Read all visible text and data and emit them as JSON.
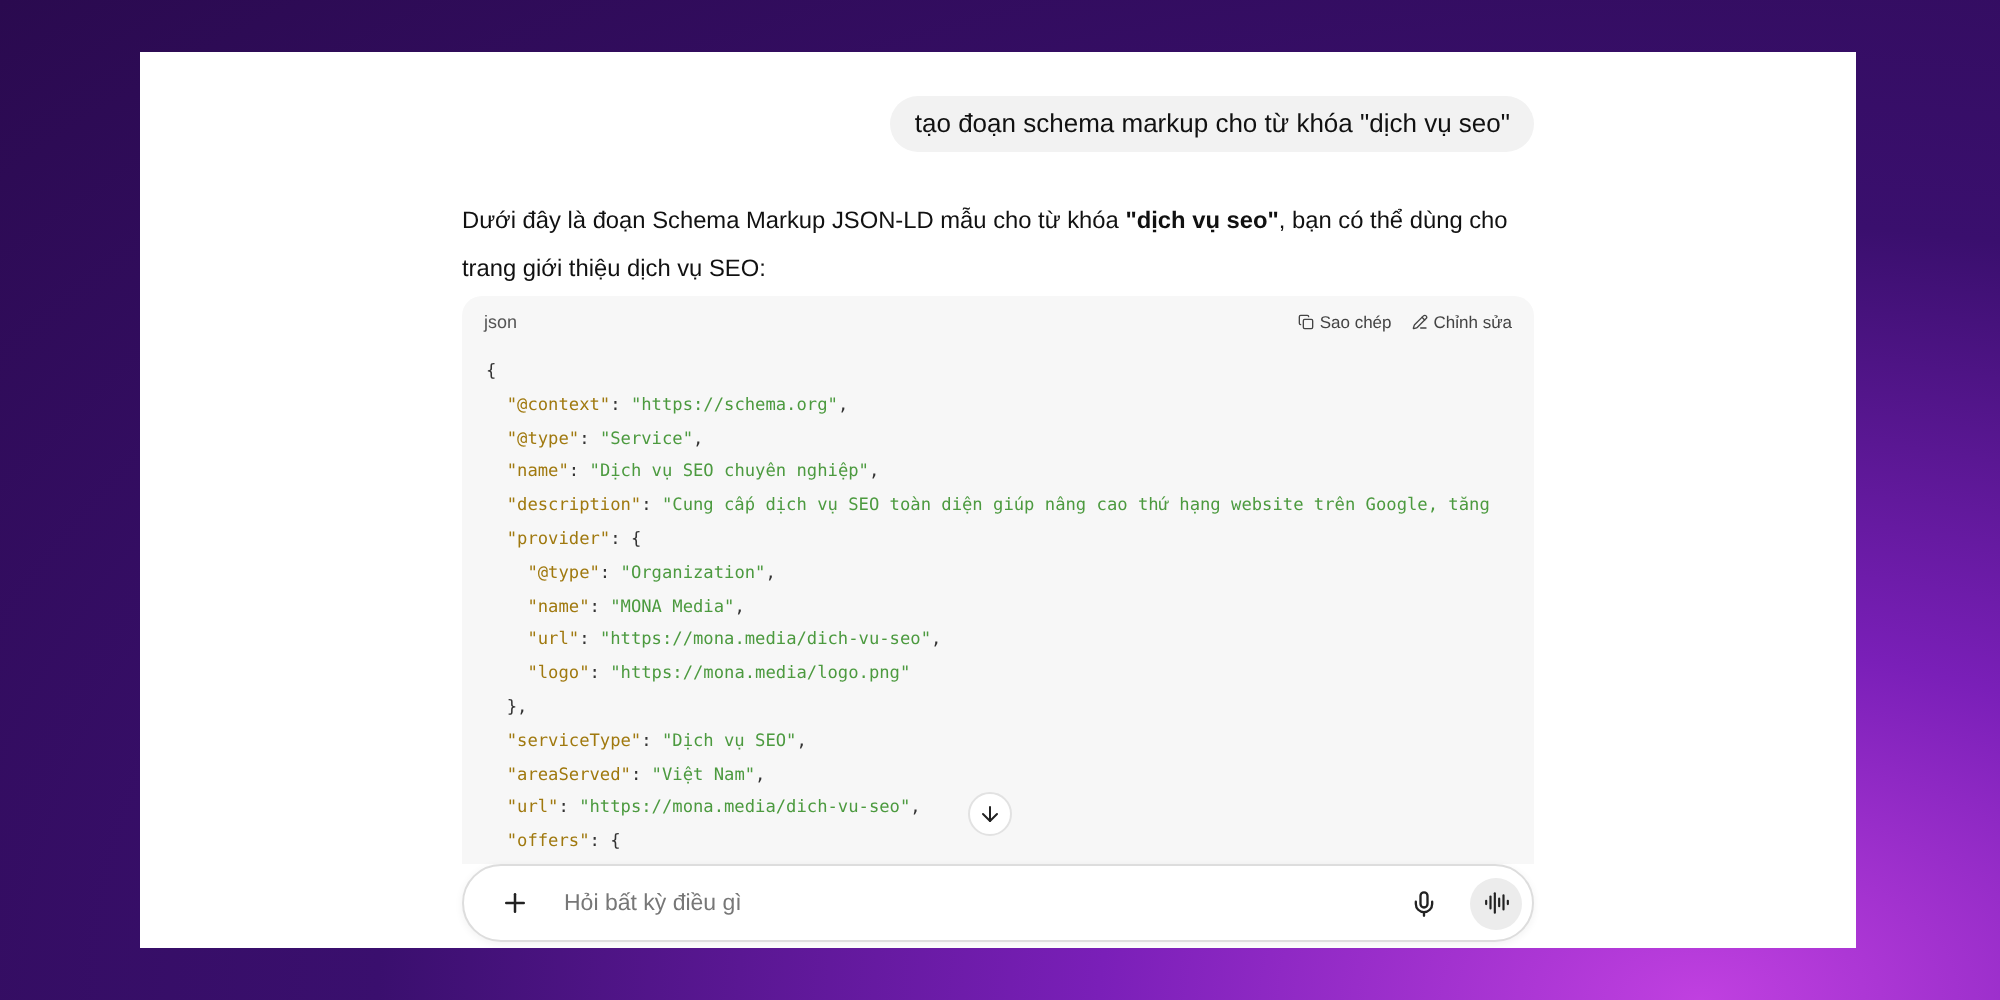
{
  "user_message": "tạo đoạn schema markup cho từ khóa \"dịch vụ seo\"",
  "assistant_message": "Dưới đây là đoạn Schema Markup JSON-LD mẫu cho từ khóa **\"dịch vụ seo\"**, bạn có thể dùng cho trang giới thiệu dịch vụ SEO:",
  "code_block": {
    "language": "json",
    "actions": [
      {
        "kind": "copy",
        "label": "Sao chép"
      },
      {
        "kind": "edit",
        "label": "Chỉnh sửa"
      }
    ],
    "lines": [
      {
        "tokens": [
          {
            "kind": "punct",
            "text": "{"
          }
        ]
      },
      {
        "tokens": [
          {
            "kind": "key",
            "text": "  \"@context\""
          },
          {
            "kind": "punct",
            "text": ": "
          },
          {
            "kind": "string",
            "text": "\"https://schema.org\""
          },
          {
            "kind": "punct",
            "text": ","
          }
        ]
      },
      {
        "tokens": [
          {
            "kind": "key",
            "text": "  \"@type\""
          },
          {
            "kind": "punct",
            "text": ": "
          },
          {
            "kind": "string",
            "text": "\"Service\""
          },
          {
            "kind": "punct",
            "text": ","
          }
        ]
      },
      {
        "tokens": [
          {
            "kind": "key",
            "text": "  \"name\""
          },
          {
            "kind": "punct",
            "text": ": "
          },
          {
            "kind": "string",
            "text": "\"Dịch vụ SEO chuyên nghiệp\""
          },
          {
            "kind": "punct",
            "text": ","
          }
        ]
      },
      {
        "tokens": [
          {
            "kind": "key",
            "text": "  \"description\""
          },
          {
            "kind": "punct",
            "text": ": "
          },
          {
            "kind": "string",
            "text": "\"Cung cấp dịch vụ SEO toàn diện giúp nâng cao thứ hạng website trên Google, tăng"
          }
        ]
      },
      {
        "tokens": [
          {
            "kind": "key",
            "text": "  \"provider\""
          },
          {
            "kind": "punct",
            "text": ": {"
          }
        ]
      },
      {
        "tokens": [
          {
            "kind": "key",
            "text": "    \"@type\""
          },
          {
            "kind": "punct",
            "text": ": "
          },
          {
            "kind": "string",
            "text": "\"Organization\""
          },
          {
            "kind": "punct",
            "text": ","
          }
        ]
      },
      {
        "tokens": [
          {
            "kind": "key",
            "text": "    \"name\""
          },
          {
            "kind": "punct",
            "text": ": "
          },
          {
            "kind": "string",
            "text": "\"MONA Media\""
          },
          {
            "kind": "punct",
            "text": ","
          }
        ]
      },
      {
        "tokens": [
          {
            "kind": "key",
            "text": "    \"url\""
          },
          {
            "kind": "punct",
            "text": ": "
          },
          {
            "kind": "string",
            "text": "\"https://mona.media/dich-vu-seo\""
          },
          {
            "kind": "punct",
            "text": ","
          }
        ]
      },
      {
        "tokens": [
          {
            "kind": "key",
            "text": "    \"logo\""
          },
          {
            "kind": "punct",
            "text": ": "
          },
          {
            "kind": "string",
            "text": "\"https://mona.media/logo.png\""
          }
        ]
      },
      {
        "tokens": [
          {
            "kind": "punct",
            "text": "  },"
          }
        ]
      },
      {
        "tokens": [
          {
            "kind": "key",
            "text": "  \"serviceType\""
          },
          {
            "kind": "punct",
            "text": ": "
          },
          {
            "kind": "string",
            "text": "\"Dịch vụ SEO\""
          },
          {
            "kind": "punct",
            "text": ","
          }
        ]
      },
      {
        "tokens": [
          {
            "kind": "key",
            "text": "  \"areaServed\""
          },
          {
            "kind": "punct",
            "text": ": "
          },
          {
            "kind": "string",
            "text": "\"Việt Nam\""
          },
          {
            "kind": "punct",
            "text": ","
          }
        ]
      },
      {
        "tokens": [
          {
            "kind": "key",
            "text": "  \"url\""
          },
          {
            "kind": "punct",
            "text": ": "
          },
          {
            "kind": "string",
            "text": "\"https://mona.media/dich-vu-seo\""
          },
          {
            "kind": "punct",
            "text": ","
          }
        ]
      },
      {
        "tokens": [
          {
            "kind": "key",
            "text": "  \"offers\""
          },
          {
            "kind": "punct",
            "text": ": {"
          }
        ]
      }
    ]
  },
  "composer": {
    "placeholder": "Hỏi bất kỳ điều gì"
  }
}
